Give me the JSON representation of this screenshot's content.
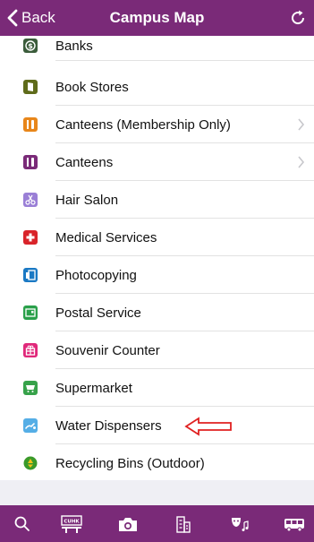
{
  "navbar": {
    "back_label": "Back",
    "title": "Campus Map"
  },
  "items": [
    {
      "label": "Banks",
      "icon": "bank-icon",
      "color": "#3b5c3b",
      "chevron": false
    },
    {
      "label": "Book Stores",
      "icon": "book-store-icon",
      "color": "#5f6b1a",
      "chevron": false
    },
    {
      "label": "Canteens (Membership Only)",
      "icon": "canteen-member-icon",
      "color": "#e8861a",
      "chevron": true
    },
    {
      "label": "Canteens",
      "icon": "canteen-icon",
      "color": "#7a2a78",
      "chevron": true
    },
    {
      "label": "Hair Salon",
      "icon": "hair-salon-icon",
      "color": "#9a7fd6",
      "chevron": false
    },
    {
      "label": "Medical Services",
      "icon": "medical-cross-icon",
      "color": "#d9242a",
      "chevron": false
    },
    {
      "label": "Photocopying",
      "icon": "photocopy-icon",
      "color": "#1a79c4",
      "chevron": false
    },
    {
      "label": "Postal Service",
      "icon": "postal-icon",
      "color": "#2aa04a",
      "chevron": false
    },
    {
      "label": "Souvenir Counter",
      "icon": "souvenir-icon",
      "color": "#e0287a",
      "chevron": false
    },
    {
      "label": "Supermarket",
      "icon": "supermarket-cart-icon",
      "color": "#37a24a",
      "chevron": false
    },
    {
      "label": "Water Dispensers",
      "icon": "water-dispenser-icon",
      "color": "#55aee6",
      "chevron": false
    },
    {
      "label": "Recycling Bins (Outdoor)",
      "icon": "recycling-icon",
      "color": "#3a9a2a",
      "chevron": false
    }
  ],
  "tabbar": {
    "items": [
      {
        "icon": "search-icon"
      },
      {
        "icon": "cuhk-sign-icon",
        "text": "CUHK"
      },
      {
        "icon": "camera-icon"
      },
      {
        "icon": "building-icon"
      },
      {
        "icon": "masks-music-icon"
      },
      {
        "icon": "bus-icon"
      }
    ]
  },
  "colors": {
    "brand": "#7a2a78",
    "annotation_arrow": "#e02020"
  }
}
